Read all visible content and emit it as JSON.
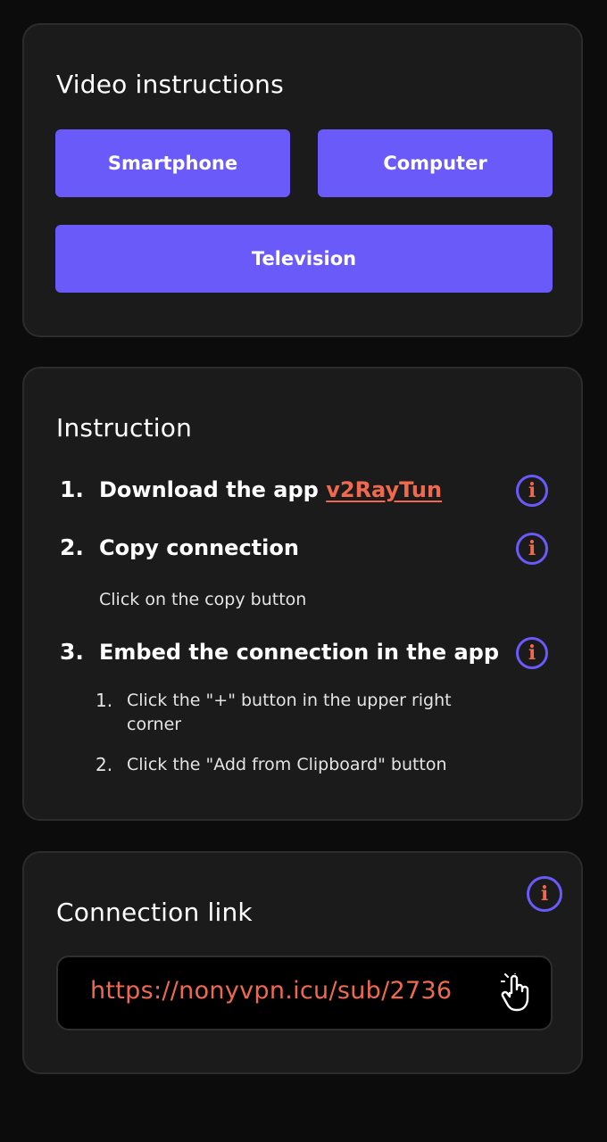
{
  "video_section": {
    "title": "Video instructions",
    "buttons": {
      "smartphone": "Smartphone",
      "computer": "Computer",
      "television": "Television"
    }
  },
  "instruction_section": {
    "title": "Instruction",
    "steps": [
      {
        "number": "1.",
        "text": "Download the app ",
        "link": "v2RayTun",
        "info_icon": "info-icon"
      },
      {
        "number": "2.",
        "text": "Copy connection",
        "description": "Click on the copy button",
        "info_icon": "info-icon"
      },
      {
        "number": "3.",
        "text": "Embed the connection in the app",
        "info_icon": "info-icon",
        "substeps": [
          {
            "number": "1.",
            "text": "Click the \"+\" button in the upper right corner"
          },
          {
            "number": "2.",
            "text": "Click the \"Add from Clipboard\" button"
          }
        ]
      }
    ]
  },
  "connection_section": {
    "title": "Connection link",
    "link": "https://nonyvpn.icu/sub/2736",
    "copy_icon": "hand-pointer-icon",
    "info_icon": "info-icon"
  },
  "colors": {
    "background": "#0c0c0c",
    "card": "#1b1b1b",
    "accent": "#6a5af9",
    "link": "#f0694f"
  }
}
